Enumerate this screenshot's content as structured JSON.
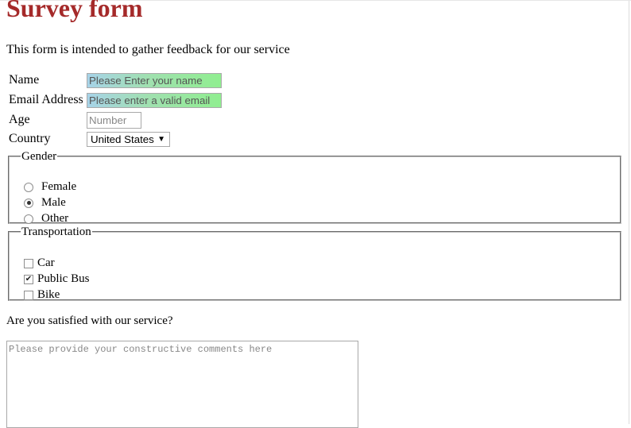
{
  "form": {
    "title": "Survey form",
    "description": "This form is intended to gather feedback for our service",
    "name": {
      "label": "Name",
      "placeholder": "Please Enter your name"
    },
    "email": {
      "label": "Email Address",
      "placeholder": "Please enter a valid email"
    },
    "age": {
      "label": "Age",
      "placeholder": "Number"
    },
    "country": {
      "label": "Country",
      "selected": "United States"
    },
    "gender": {
      "legend": "Gender",
      "options": [
        {
          "label": "Female",
          "checked": false
        },
        {
          "label": "Male",
          "checked": true
        },
        {
          "label": "Other",
          "checked": false
        }
      ]
    },
    "transportation": {
      "legend": "Transportation",
      "options": [
        {
          "label": "Car",
          "checked": false
        },
        {
          "label": "Public Bus",
          "checked": true
        },
        {
          "label": "Bike",
          "checked": false
        }
      ]
    },
    "satisfaction": {
      "question": "Are you satisfied with our service?",
      "placeholder": "Please provide your constructive comments here"
    }
  },
  "colors": {
    "title": "#a52a2a",
    "input_gradient_start": "#a7d3e8",
    "input_gradient_end": "#90ee90"
  }
}
